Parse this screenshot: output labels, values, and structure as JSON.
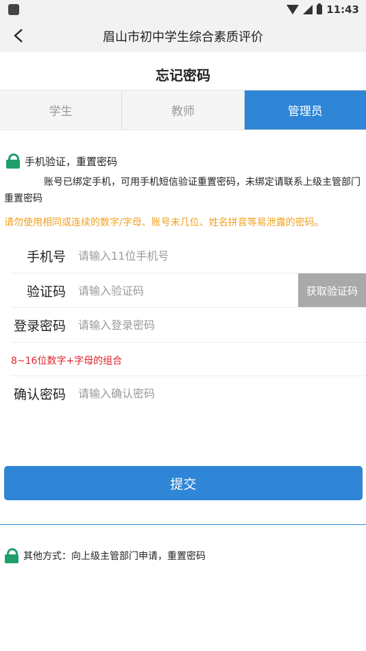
{
  "status_bar": {
    "time": "11:43"
  },
  "nav": {
    "title": "眉山市初中学生综合素质评价",
    "back_icon": "‹"
  },
  "page": {
    "heading": "忘记密码"
  },
  "tabs": [
    {
      "label": "学生"
    },
    {
      "label": "教师"
    },
    {
      "label": "管理员"
    }
  ],
  "section": {
    "title": "手机验证，重置密码",
    "description": "账号已绑定手机，可用手机短信验证重置密码，未绑定请联系上级主管部门重置密码",
    "warning": "请勿使用相同或连续的数字/字母、账号末几位、姓名拼音等易泄露的密码。"
  },
  "form": {
    "phone": {
      "label": "手机号",
      "placeholder": "请输入11位手机号",
      "value": ""
    },
    "code": {
      "label": "验证码",
      "placeholder": "请输入验证码",
      "value": "",
      "button": "获取验证码"
    },
    "password": {
      "label": "登录密码",
      "placeholder": "请输入登录密码",
      "value": ""
    },
    "password_hint": "8~16位数字+字母的组合",
    "confirm": {
      "label": "确认密码",
      "placeholder": "请输入确认密码",
      "value": ""
    }
  },
  "submit_label": "提交",
  "other": {
    "text": "其他方式：向上级主管部门申请，重置密码"
  },
  "colors": {
    "primary": "#2f86d6",
    "warning": "#f0a020",
    "error": "#e0202a",
    "lock": "#1f9e6a"
  }
}
